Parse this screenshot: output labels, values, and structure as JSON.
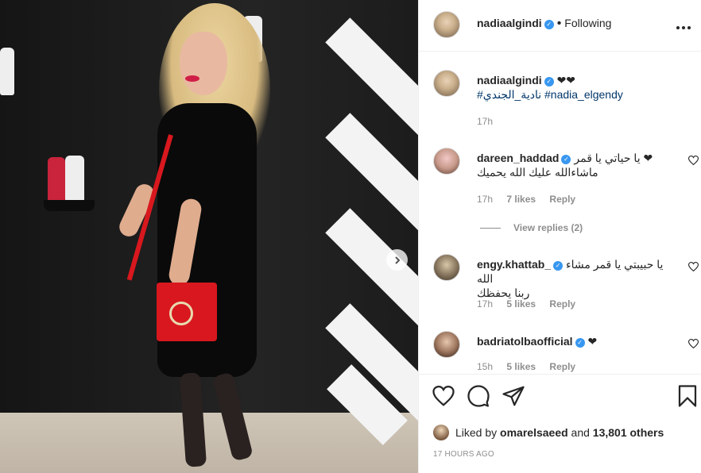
{
  "post": {
    "username": "nadiaalgindi",
    "follow_status": "Following",
    "more_icon": "more-horizontal-icon",
    "next_icon": "chevron-right-icon"
  },
  "caption": {
    "username": "nadiaalgindi",
    "text": "❤❤",
    "hashtags": "#نادية_الجندي #nadia_elgendy",
    "time": "17h"
  },
  "comments": [
    {
      "username": "dareen_haddad",
      "text_line1": "يا حياتي يا قمر ❤",
      "text_line2": "ماشاءالله عليك الله يحميك",
      "time": "17h",
      "likes": "7 likes",
      "reply": "Reply",
      "view_replies": "View replies (2)"
    },
    {
      "username": "engy.khattab_",
      "text_line1": "يا حبيبتي يا قمر مشاء الله",
      "text_line2": "ربنا يحفظك",
      "time": "17h",
      "likes": "5 likes",
      "reply": "Reply"
    },
    {
      "username": "badriatolbaofficial",
      "text_line1": "❤",
      "time": "15h",
      "likes": "5 likes",
      "reply": "Reply"
    }
  ],
  "likes_bar": {
    "prefix": "Liked by",
    "user": "omarelsaeed",
    "and": "and",
    "count": "13,801 others"
  },
  "timestamp": "17 HOURS AGO"
}
